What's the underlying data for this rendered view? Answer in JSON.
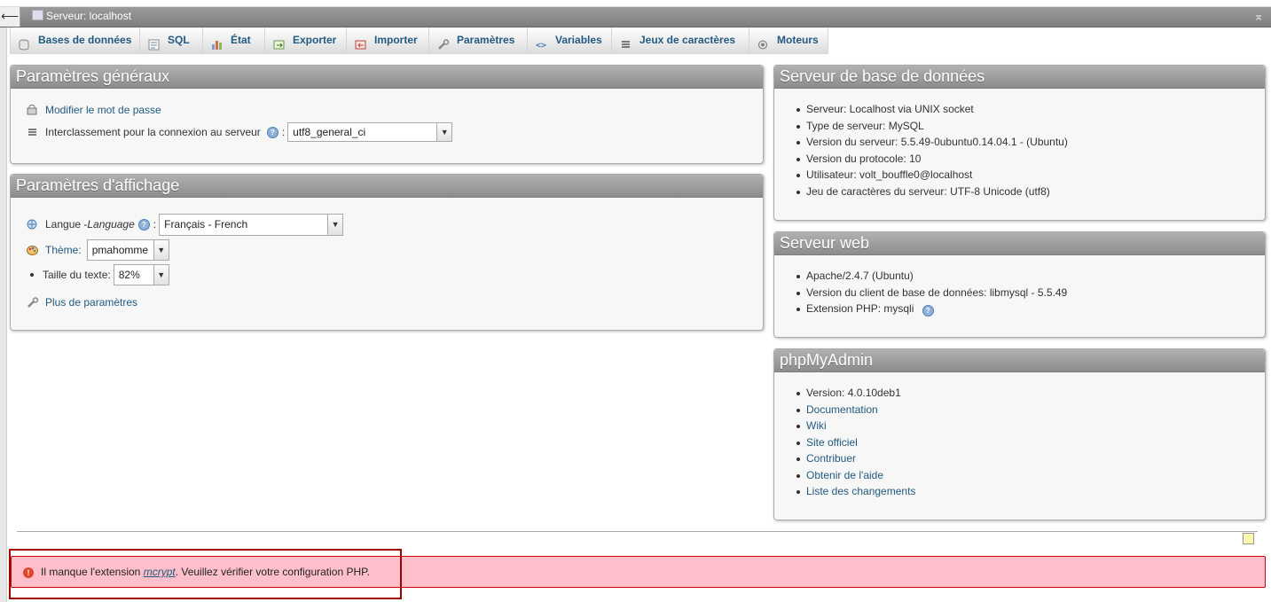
{
  "server_bar": {
    "title": "Serveur: localhost",
    "back_symbol": "⟵",
    "collapse_symbol": "⌅"
  },
  "tabs": [
    {
      "label": "Bases de données",
      "icon": "database-icon"
    },
    {
      "label": "SQL",
      "icon": "sql-icon"
    },
    {
      "label": "État",
      "icon": "status-chart-icon"
    },
    {
      "label": "Exporter",
      "icon": "export-icon"
    },
    {
      "label": "Importer",
      "icon": "import-icon"
    },
    {
      "label": "Paramètres",
      "icon": "wrench-icon"
    },
    {
      "label": "Variables",
      "icon": "variables-icon"
    },
    {
      "label": "Jeux de caractères",
      "icon": "charset-icon"
    },
    {
      "label": "Moteurs",
      "icon": "engine-icon"
    }
  ],
  "general": {
    "title": "Paramètres généraux",
    "change_password": "Modifier le mot de passe",
    "collation_label": "Interclassement pour la connexion au serveur",
    "colon": ":",
    "collation_value": "utf8_general_ci"
  },
  "display": {
    "title": "Paramètres d'affichage",
    "language_label": "Langue - ",
    "language_label_italic": "Language",
    "colon": ":",
    "language_value": "Français - French",
    "theme_label": "Thème:",
    "theme_value": "pmahomme",
    "fontsize_label": "Taille du texte:",
    "fontsize_value": "82%",
    "more_settings": "Plus de paramètres"
  },
  "db_server": {
    "title": "Serveur de base de données",
    "items": [
      "Serveur: Localhost via UNIX socket",
      "Type de serveur: MySQL",
      "Version du serveur: 5.5.49-0ubuntu0.14.04.1 - (Ubuntu)",
      "Version du protocole: 10",
      "Utilisateur: volt_bouffle0@localhost",
      "Jeu de caractères du serveur: UTF-8 Unicode (utf8)"
    ]
  },
  "web_server": {
    "title": "Serveur web",
    "items": [
      "Apache/2.4.7 (Ubuntu)",
      "Version du client de base de données: libmysql - 5.5.49",
      "Extension PHP: mysqli"
    ]
  },
  "pma": {
    "title": "phpMyAdmin",
    "version": "Version: 4.0.10deb1",
    "links": [
      "Documentation",
      "Wiki",
      "Site officiel",
      "Contribuer",
      "Obtenir de l'aide",
      "Liste des changements"
    ]
  },
  "error": {
    "prefix": "Il manque l'extension ",
    "link": "mcrypt",
    "suffix": ". Veuillez vérifier votre configuration PHP."
  },
  "colors": {
    "link": "#235a81",
    "error_bg": "#ffc0cb",
    "error_border": "#cc0000",
    "highlight_box": "#a00000"
  }
}
